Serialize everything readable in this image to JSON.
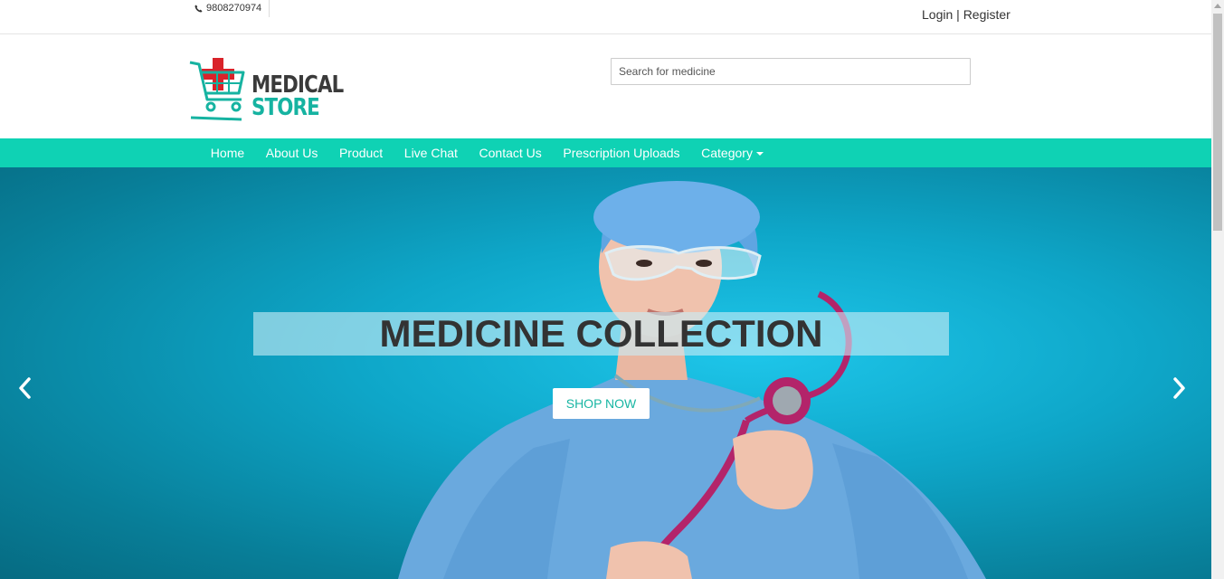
{
  "topbar": {
    "phone": "9808270974",
    "login_label": "Login",
    "separator": " | ",
    "register_label": "Register"
  },
  "header": {
    "logo_line1": "MEDICAL",
    "logo_line2": "STORE",
    "search_placeholder": "Search for medicine"
  },
  "nav": {
    "items": [
      {
        "label": "Home"
      },
      {
        "label": "About Us"
      },
      {
        "label": "Product"
      },
      {
        "label": "Live Chat"
      },
      {
        "label": "Contact Us"
      },
      {
        "label": "Prescription Uploads"
      },
      {
        "label": "Category"
      }
    ]
  },
  "hero": {
    "caption": "MEDICINE COLLECTION",
    "button_label": "SHOP NOW",
    "prev_icon": "chevron-left-icon",
    "next_icon": "chevron-right-icon"
  },
  "colors": {
    "nav_bg": "#0fd2b4",
    "brand_teal": "#16b3a1",
    "brand_red": "#d9232a",
    "hero_bg": "#0ea6c8"
  }
}
